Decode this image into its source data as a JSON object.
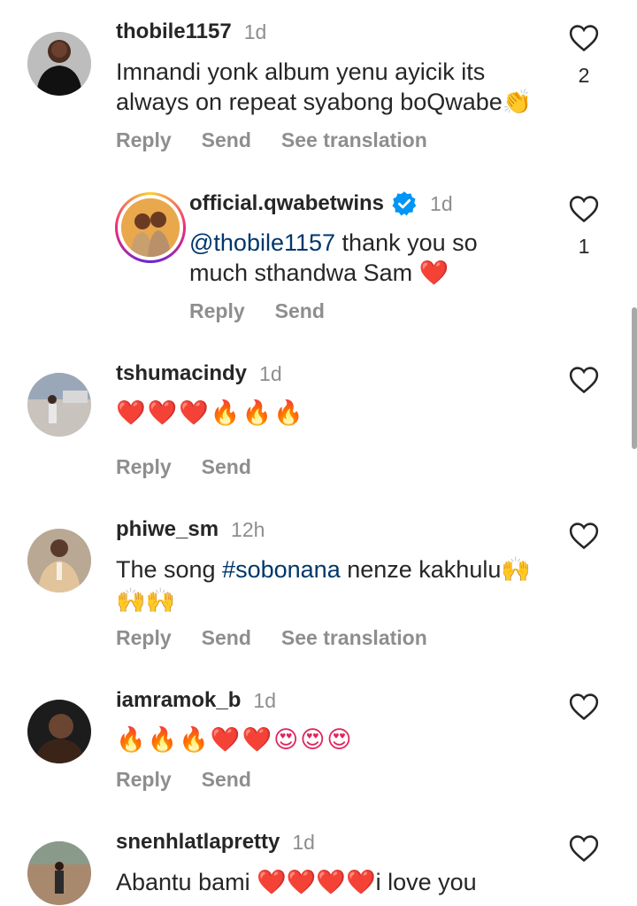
{
  "colors": {
    "text": "#262626",
    "secondary": "#8e8e8e",
    "link": "#00376b",
    "verified": "#0095f6"
  },
  "comments": [
    {
      "username": "thobile1157",
      "time": "1d",
      "text_line1": "Imnandi yonk album yenu ayicik its",
      "text_line2": "always on repeat syabong boQwabe",
      "text_emoji": "👏",
      "likes": "2",
      "reply": "Reply",
      "send": "Send",
      "translate": "See translation",
      "avatar_icon": "avatar-woman-black-top"
    },
    {
      "username": "official.qwabetwins",
      "time": "1d",
      "verified_icon": "verified-badge-icon",
      "mention": "@thobile1157",
      "text_rest1": " thank you so",
      "text_line2": "much sthandwa Sam ",
      "text_emoji": "❤️",
      "likes": "1",
      "reply": "Reply",
      "send": "Send",
      "avatar_icon": "avatar-twins"
    },
    {
      "username": "tshumacindy",
      "time": "1d",
      "text_emoji": "❤️❤️❤️🔥🔥🔥",
      "reply": "Reply",
      "send": "Send",
      "avatar_icon": "avatar-outdoor"
    },
    {
      "username": "phiwe_sm",
      "time": "12h",
      "text_prefix": "The song ",
      "hashtag": "#sobonana",
      "text_rest1": " nenze kakhulu",
      "text_emoji1": "🙌",
      "text_emoji2": "🙌🙌",
      "reply": "Reply",
      "send": "Send",
      "translate": "See translation",
      "avatar_icon": "avatar-man-suit"
    },
    {
      "username": "iamramok_b",
      "time": "1d",
      "text_emoji": "🔥🔥🔥❤️❤️😍😍😍",
      "reply": "Reply",
      "send": "Send",
      "avatar_icon": "avatar-woman-dark"
    },
    {
      "username": "snenhlatlapretty",
      "time": "1d",
      "text_prefix": "Abantu bami ",
      "text_emoji": "❤️❤️❤️❤️",
      "text_rest1": "i love you",
      "avatar_icon": "avatar-person-standing"
    }
  ]
}
